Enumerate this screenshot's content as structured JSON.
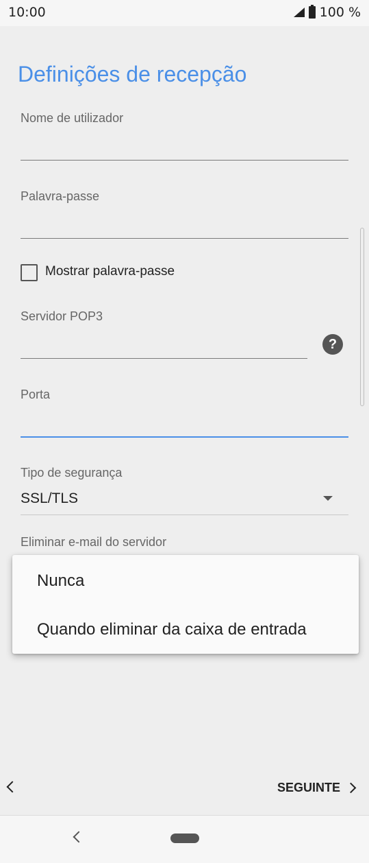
{
  "status_bar": {
    "time": "10:00",
    "battery": "100 %"
  },
  "page": {
    "title": "Definições de recepção",
    "fields": {
      "username_label": "Nome de utilizador",
      "password_label": "Palavra-passe",
      "show_password_label": "Mostrar palavra-passe",
      "server_label": "Servidor POP3",
      "port_label": "Porta",
      "security_label": "Tipo de segurança",
      "security_value": "SSL/TLS",
      "delete_label": "Eliminar e-mail do servidor"
    },
    "help_symbol": "?"
  },
  "dropdown": {
    "options": [
      "Nunca",
      "Quando eliminar da caixa de entrada"
    ]
  },
  "footer": {
    "next_label": "SEGUINTE"
  }
}
